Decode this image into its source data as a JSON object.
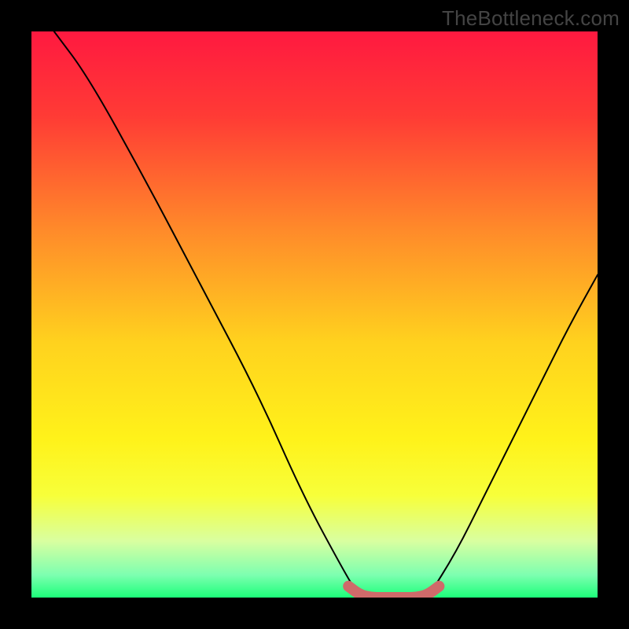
{
  "watermark": "TheBottleneck.com",
  "chart_data": {
    "type": "line",
    "title": "",
    "xlabel": "",
    "ylabel": "",
    "xlim": [
      0,
      100
    ],
    "ylim": [
      0,
      100
    ],
    "series": [
      {
        "name": "curve-left",
        "x": [
          4,
          10,
          20,
          30,
          40,
          48,
          55,
          58
        ],
        "values": [
          100,
          92,
          74,
          55,
          36,
          18,
          5,
          0
        ]
      },
      {
        "name": "curve-right",
        "x": [
          70,
          75,
          80,
          85,
          90,
          95,
          100
        ],
        "values": [
          0,
          8,
          18,
          28,
          38,
          48,
          57
        ]
      },
      {
        "name": "bottom-segment",
        "x": [
          56,
          58,
          60,
          62,
          64,
          66,
          68,
          70,
          72
        ],
        "values": [
          2,
          0.5,
          0,
          0,
          0,
          0,
          0,
          0.5,
          2
        ]
      }
    ],
    "gradient_stops": [
      {
        "offset": 0.0,
        "color": "#ff1940"
      },
      {
        "offset": 0.15,
        "color": "#ff3b35"
      },
      {
        "offset": 0.35,
        "color": "#ff8a2a"
      },
      {
        "offset": 0.55,
        "color": "#ffd21e"
      },
      {
        "offset": 0.72,
        "color": "#fff21a"
      },
      {
        "offset": 0.82,
        "color": "#f7ff3a"
      },
      {
        "offset": 0.9,
        "color": "#d9ffa0"
      },
      {
        "offset": 0.96,
        "color": "#7dffb0"
      },
      {
        "offset": 1.0,
        "color": "#1cff7a"
      }
    ],
    "bottom_curve_color": "#cf6a6a",
    "curve_color": "#000000"
  }
}
